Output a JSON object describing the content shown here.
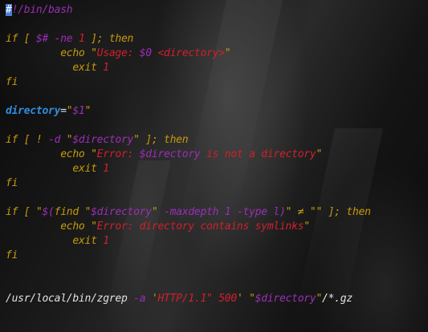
{
  "editor": {
    "colors": {
      "keyword": "#c79a0d",
      "variable": "#9a2fb8",
      "string": "#d0202c",
      "identifier": "#2f8fe0",
      "plain": "#e2e2e2",
      "cursor": "#4a7ed6"
    },
    "cursor_line": 1,
    "cursor_column": 1,
    "lines": [
      "#!/bin/bash",
      "",
      "if [ $# -ne 1 ]; then",
      "         echo \"Usage: $0 <directory>\"",
      "           exit 1",
      "fi",
      "",
      "directory=\"$1\"",
      "",
      "if [ ! -d \"$directory\" ]; then",
      "         echo \"Error: $directory is not a directory\"",
      "           exit 1",
      "fi",
      "",
      "if [ \"$(find \"$directory\" -maxdepth 1 -type l)\" ≠ \"\" ]; then",
      "         echo \"Error: directory contains symlinks\"",
      "           exit 1",
      "fi",
      "",
      "",
      "/usr/local/bin/zgrep -a 'HTTP/1.1\" 500' \"$directory\"/*.gz"
    ]
  }
}
